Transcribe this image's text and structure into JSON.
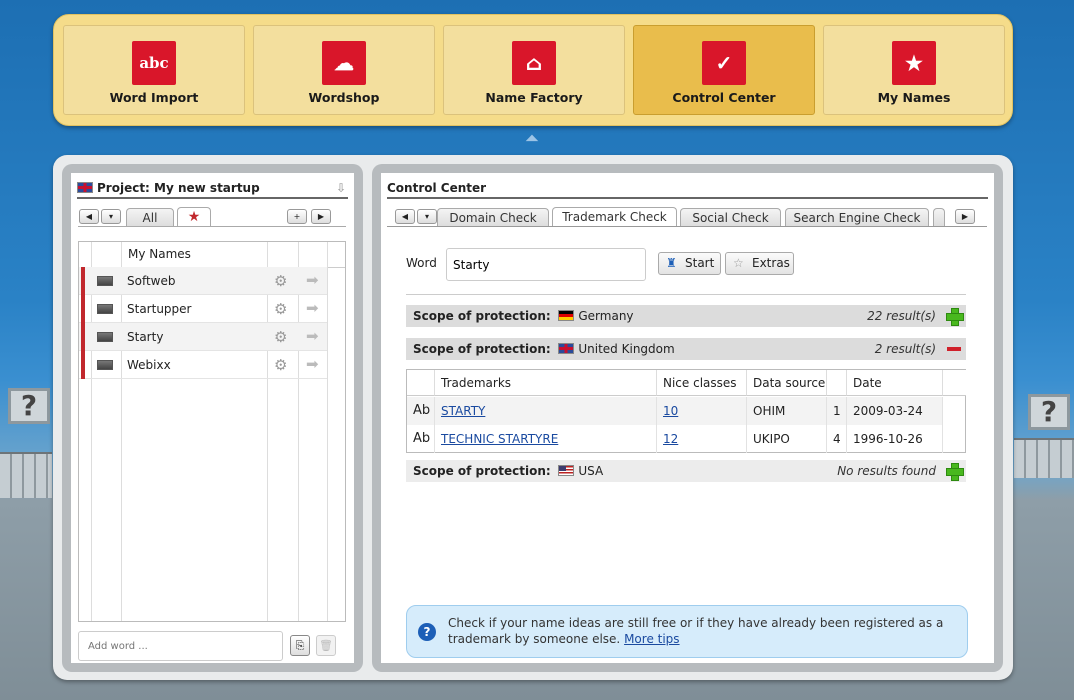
{
  "toolbar": {
    "items": [
      {
        "label": "Word Import",
        "icon": "abc-icon",
        "glyph": "abc",
        "active": false
      },
      {
        "label": "Wordshop",
        "icon": "cloud-icon",
        "glyph": "☁",
        "active": false
      },
      {
        "label": "Name Factory",
        "icon": "factory-icon",
        "glyph": "⌂",
        "active": false
      },
      {
        "label": "Control Center",
        "icon": "check-icon",
        "glyph": "✓",
        "active": true
      },
      {
        "label": "My Names",
        "icon": "star-icon",
        "glyph": "★",
        "active": false
      }
    ]
  },
  "project": {
    "title": "Project: My new startup",
    "tabs": {
      "all": "All"
    },
    "header": "My Names",
    "names": [
      "Softweb",
      "Startupper",
      "Starty",
      "Webixx"
    ],
    "add_placeholder": "Add word ..."
  },
  "control": {
    "title": "Control Center",
    "tabs": [
      "Domain Check",
      "Trademark Check",
      "Social Check",
      "Search Engine Check"
    ],
    "active_tab": "Trademark Check",
    "word_label": "Word",
    "word_value": "Starty",
    "start_label": "Start",
    "extras_label": "Extras",
    "scope_prefix": "Scope of protection:",
    "scopes": [
      {
        "country": "Germany",
        "results": "22 result(s)",
        "expanded": false
      },
      {
        "country": "United Kingdom",
        "results": "2 result(s)",
        "expanded": true
      },
      {
        "country": "USA",
        "results": "No results found",
        "expanded": false
      }
    ],
    "table": {
      "headers": [
        "Trademarks",
        "Nice classes",
        "Data source",
        "Date"
      ],
      "rows": [
        {
          "icon": "Ab",
          "name": "STARTY",
          "nice": "10",
          "source": "OHIM",
          "count": "1",
          "date": "2009-03-24"
        },
        {
          "icon": "Ab",
          "name": "TECHNIC STARTYRE",
          "nice": "12",
          "source": "UKIPO",
          "count": "4",
          "date": "1996-10-26"
        }
      ]
    },
    "tip": {
      "text": "Check if your name ideas are still free or if they have already been registered as a trademark by someone else.",
      "link": "More tips"
    }
  },
  "colors": {
    "accent_red": "#d9162a",
    "toolbar_bg": "#f5dc8a",
    "active_tool": "#e9bd4c",
    "link": "#1a4aa0"
  }
}
